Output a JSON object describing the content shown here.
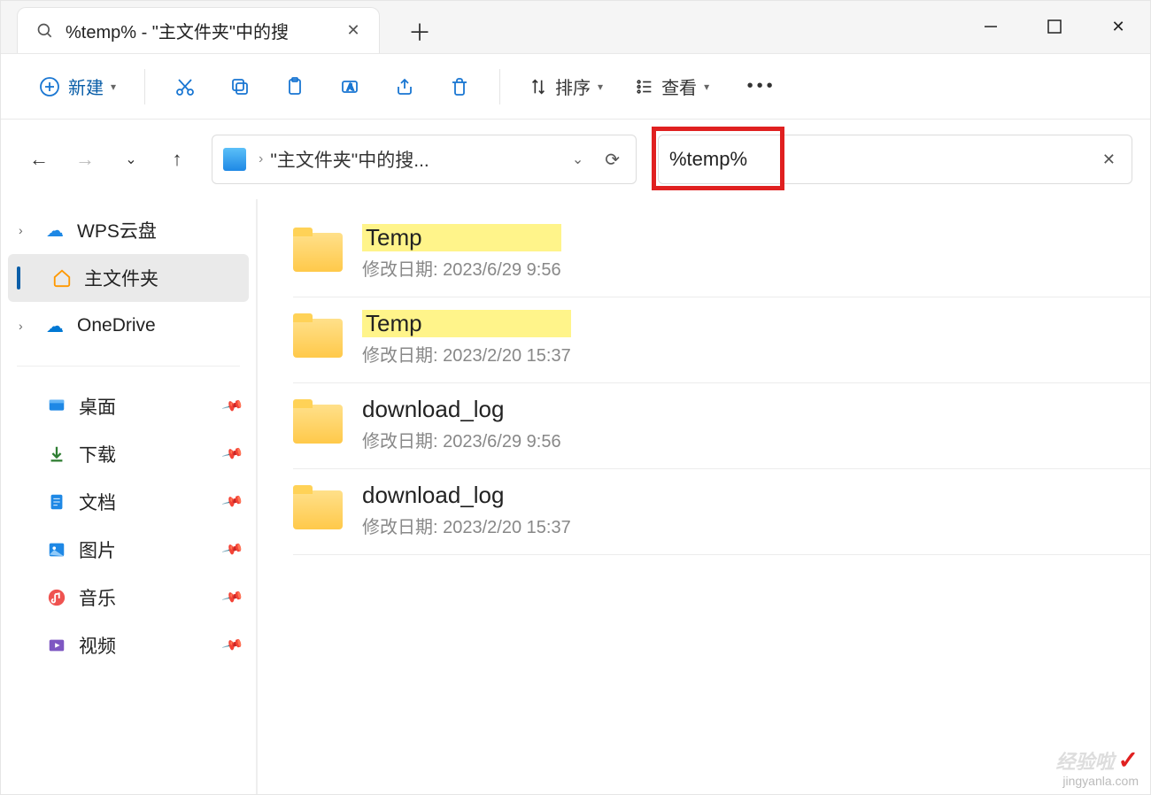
{
  "tab": {
    "title": "%temp% - \"主文件夹\"中的搜"
  },
  "toolbar": {
    "new_label": "新建",
    "sort_label": "排序",
    "view_label": "查看"
  },
  "breadcrumb": {
    "text": "\"主文件夹\"中的搜..."
  },
  "search": {
    "value": "%temp%"
  },
  "sidebar": {
    "cloud1": "WPS云盘",
    "home": "主文件夹",
    "onedrive": "OneDrive",
    "quick": [
      {
        "label": "桌面"
      },
      {
        "label": "下载"
      },
      {
        "label": "文档"
      },
      {
        "label": "图片"
      },
      {
        "label": "音乐"
      },
      {
        "label": "视频"
      }
    ]
  },
  "meta_label": "修改日期:",
  "results": [
    {
      "name": "Temp",
      "highlighted": true,
      "date": "2023/6/29 9:56"
    },
    {
      "name": "Temp",
      "highlighted": true,
      "date": "2023/2/20 15:37"
    },
    {
      "name": "download_log",
      "highlighted": false,
      "date": "2023/6/29 9:56"
    },
    {
      "name": "download_log",
      "highlighted": false,
      "date": "2023/2/20 15:37"
    }
  ],
  "watermark": {
    "brand": "经验啦",
    "url": "jingyanla.com",
    "check": "✓"
  }
}
